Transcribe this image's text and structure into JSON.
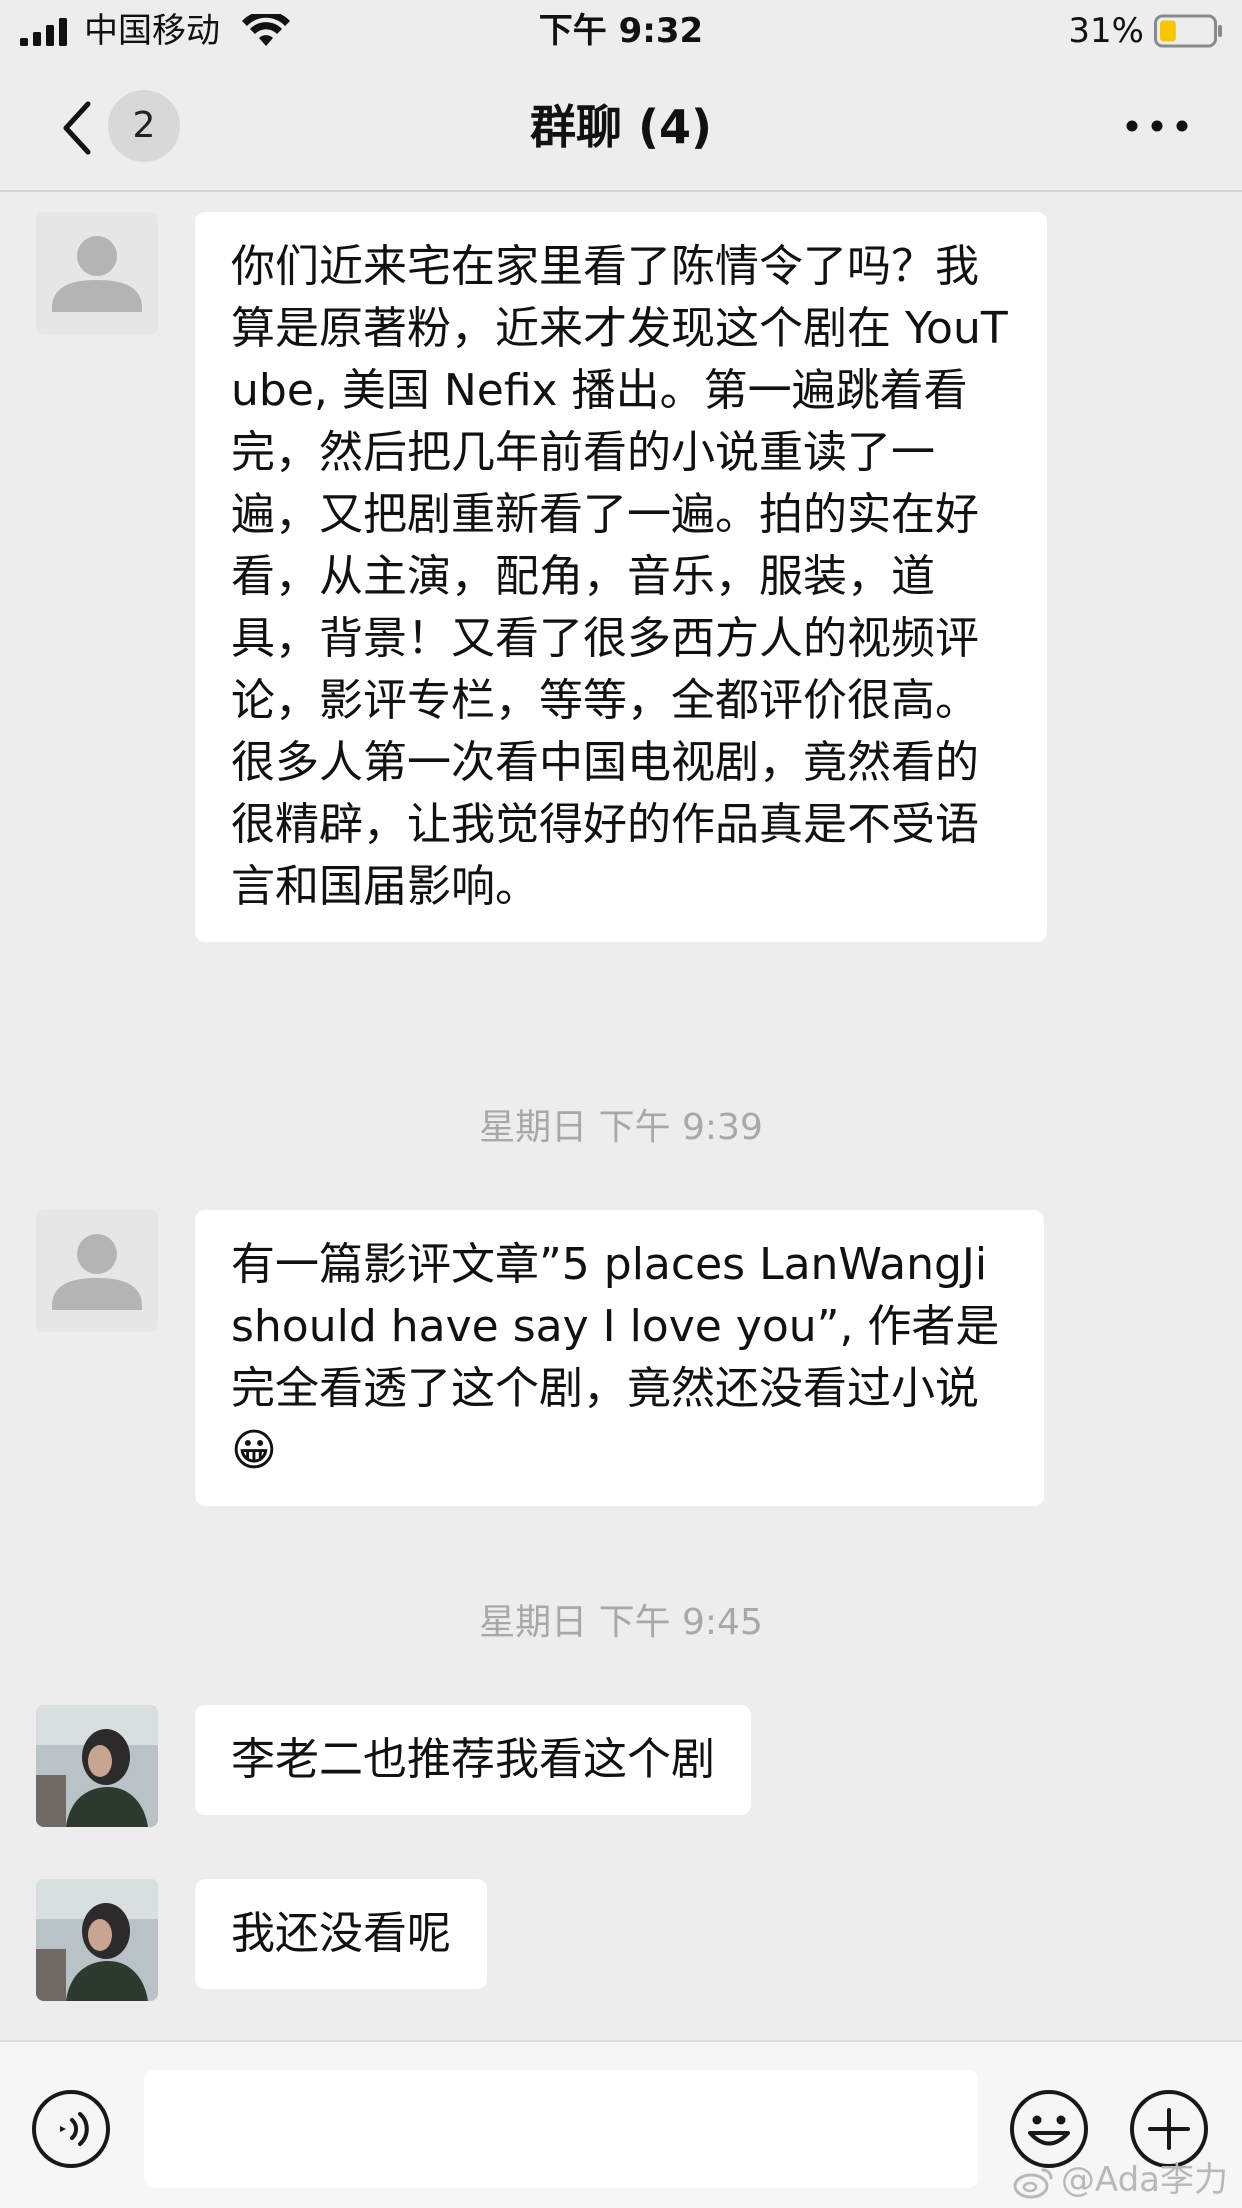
{
  "status_bar": {
    "carrier": "中国移动",
    "time": "下午 9:32",
    "battery_percent": "31%",
    "battery_level": 0.31,
    "signal_icon": "signal-icon",
    "wifi_icon": "wifi-icon",
    "battery_icon": "battery-icon"
  },
  "nav": {
    "title": "群聊 (4)",
    "unread_count": "2",
    "back_icon": "chevron-left-icon",
    "more_icon": "more-icon"
  },
  "messages": [
    {
      "avatar": "default-avatar",
      "text": "你们近来宅在家里看了陈情令了吗？我算是原著粉，近来才发现这个剧在 YouTube, 美国 Nefix 播出。第一遍跳着看完，然后把几年前看的小说重读了一遍，又把剧重新看了一遍。拍的实在好看，从主演，配角，音乐，服装，道具，背景！又看了很多西方人的视频评论，影评专栏，等等，全都评价很高。很多人第一次看中国电视剧，竟然看的很精辟，让我觉得好的作品真是不受语言和国届影响。"
    },
    {
      "avatar": "default-avatar",
      "text": "有一篇影评文章”5 places LanWangJi should have say I love you”, 作者是完全看透了这个剧，竟然还没看过小说😀"
    },
    {
      "avatar": "photo-avatar",
      "text": "李老二也推荐我看这个剧"
    },
    {
      "avatar": "photo-avatar",
      "text": "我还没看呢"
    }
  ],
  "timestamps": [
    "星期日 下午 9:39",
    "星期日 下午 9:45"
  ],
  "input_bar": {
    "voice_icon": "voice-icon",
    "emoji_icon": "emoji-icon",
    "plus_icon": "plus-icon"
  },
  "watermark": "@Ada李力",
  "colors": {
    "background": "#ededed",
    "bubble": "#ffffff",
    "timestamp": "#a8a8a8",
    "battery_fill": "#f7c600"
  }
}
